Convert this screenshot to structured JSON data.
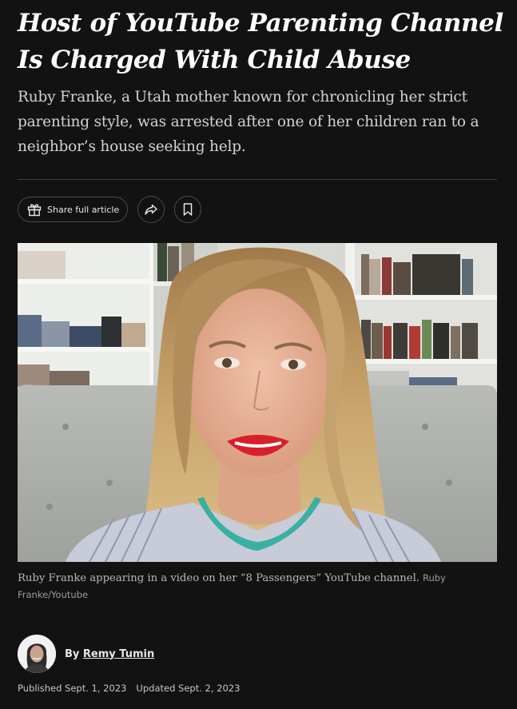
{
  "article": {
    "headline": "Host of YouTube Parenting Channel Is Charged With Child Abuse",
    "summary": "Ruby Franke, a Utah mother known for chronicling her strict parenting style, was arrested after one of her children ran to a neighbor’s house seeking help.",
    "caption": "Ruby Franke appearing in a video on her “8 Passengers” YouTube channel.",
    "credit": "Ruby Franke/Youtube",
    "byline_prefix": "By",
    "author": "Remy Tumin",
    "published": "Published Sept. 1, 2023",
    "updated": "Updated Sept. 2, 2023"
  },
  "share_bar": {
    "share_label": "Share full article",
    "share_icon": "gift-icon",
    "forward_icon": "share-arrow-icon",
    "save_icon": "bookmark-icon"
  },
  "colors": {
    "background": "#121212",
    "headline": "#ffffff",
    "body_text": "#d2d2d2"
  }
}
